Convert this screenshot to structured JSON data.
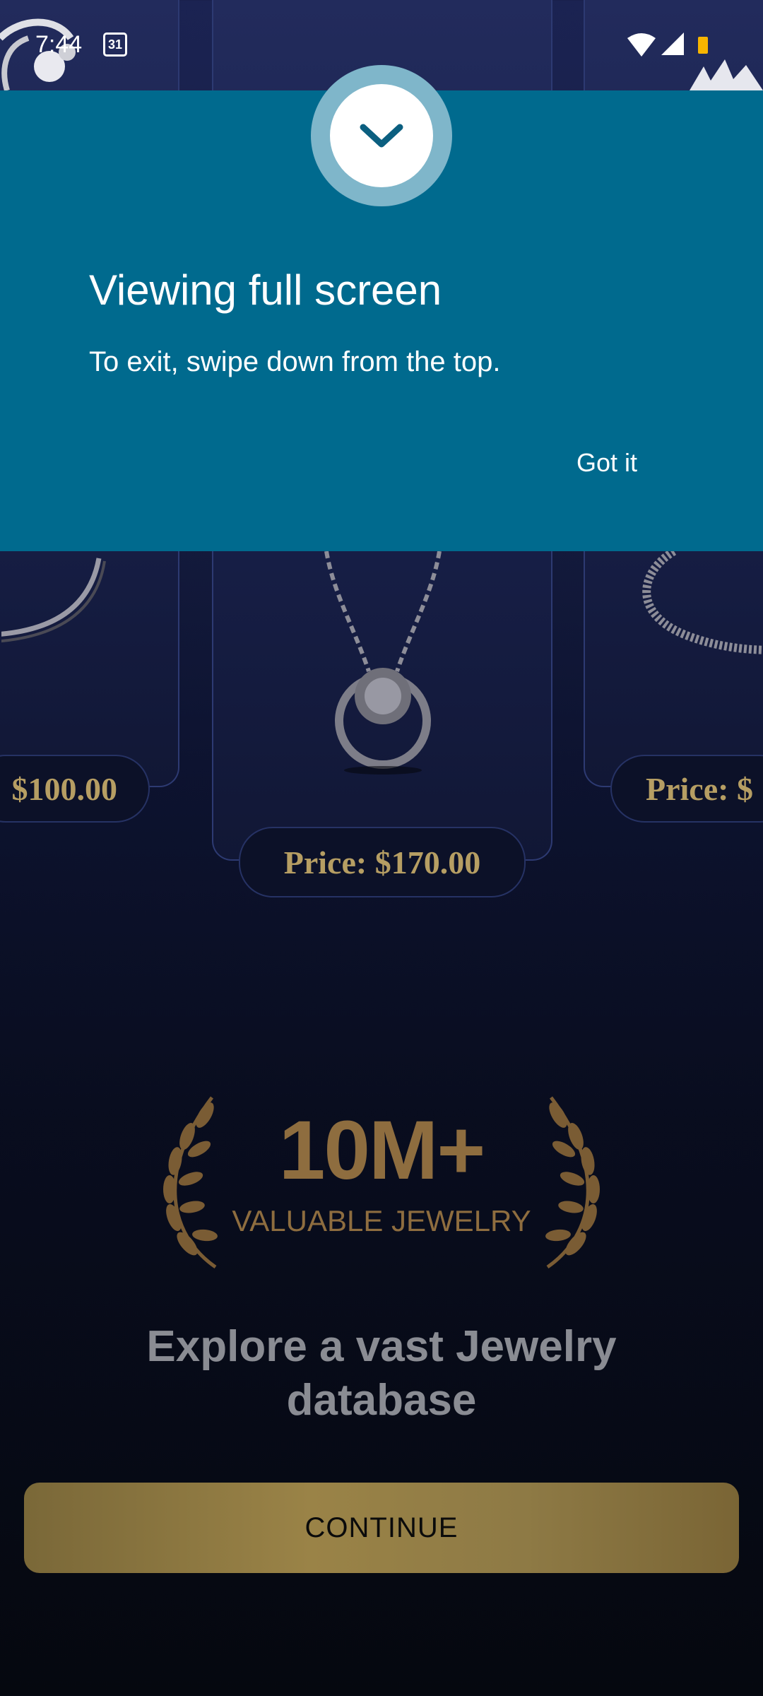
{
  "status_bar": {
    "time": "7:44",
    "calendar_day": "31",
    "icons": [
      "wifi-icon",
      "cellular-signal-icon",
      "battery-icon"
    ]
  },
  "products": [
    {
      "price": "$100.00"
    },
    {
      "price": "Price: $170.00"
    },
    {
      "price": "Price: $"
    }
  ],
  "fullscreen_banner": {
    "title": "Viewing full screen",
    "message": "To exit, swipe down from the top.",
    "button": "Got it",
    "background": "#006a8e"
  },
  "stat": {
    "value": "10M+",
    "label": "VALUABLE JEWELRY",
    "icon": "laurel-wreath-icon"
  },
  "headline": "Explore a vast Jewelry database",
  "cta": {
    "label": "CONTINUE",
    "color": "#9a8347"
  },
  "colors": {
    "gold": "#b69e63",
    "background_top": "#1b2352",
    "background_bottom": "#05080f"
  }
}
